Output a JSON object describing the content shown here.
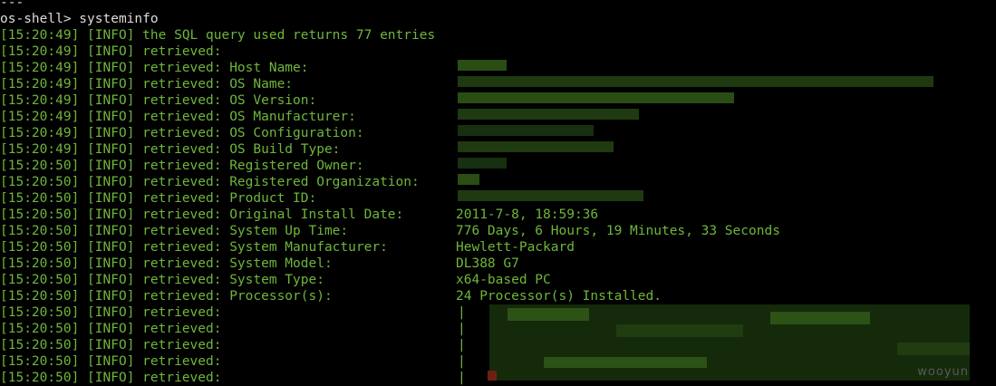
{
  "terminal": {
    "top_fragment": "---",
    "prompt": "os-shell> systeminfo",
    "lines": [
      {
        "ts": "[15:20:49]",
        "level": "[INFO]",
        "text": "the SQL query used returns 77 entries",
        "value": ""
      },
      {
        "ts": "[15:20:49]",
        "level": "[INFO]",
        "text": "retrieved:",
        "value": ""
      },
      {
        "ts": "[15:20:49]",
        "level": "[INFO]",
        "text": "retrieved: Host Name:",
        "value": ""
      },
      {
        "ts": "[15:20:49]",
        "level": "[INFO]",
        "text": "retrieved: OS Name:",
        "value": ""
      },
      {
        "ts": "[15:20:49]",
        "level": "[INFO]",
        "text": "retrieved: OS Version:",
        "value": ""
      },
      {
        "ts": "[15:20:49]",
        "level": "[INFO]",
        "text": "retrieved: OS Manufacturer:",
        "value": ""
      },
      {
        "ts": "[15:20:49]",
        "level": "[INFO]",
        "text": "retrieved: OS Configuration:",
        "value": ""
      },
      {
        "ts": "[15:20:49]",
        "level": "[INFO]",
        "text": "retrieved: OS Build Type:",
        "value": ""
      },
      {
        "ts": "[15:20:50]",
        "level": "[INFO]",
        "text": "retrieved: Registered Owner:",
        "value": ""
      },
      {
        "ts": "[15:20:50]",
        "level": "[INFO]",
        "text": "retrieved: Registered Organization:",
        "value": ""
      },
      {
        "ts": "[15:20:50]",
        "level": "[INFO]",
        "text": "retrieved: Product ID:",
        "value": ""
      },
      {
        "ts": "[15:20:50]",
        "level": "[INFO]",
        "text": "retrieved: Original Install Date:",
        "value": "2011-7-8, 18:59:36"
      },
      {
        "ts": "[15:20:50]",
        "level": "[INFO]",
        "text": "retrieved: System Up Time:",
        "value": "776 Days, 6 Hours, 19 Minutes, 33 Seconds"
      },
      {
        "ts": "[15:20:50]",
        "level": "[INFO]",
        "text": "retrieved: System Manufacturer:",
        "value": "Hewlett-Packard"
      },
      {
        "ts": "[15:20:50]",
        "level": "[INFO]",
        "text": "retrieved: System Model:",
        "value": "DL388 G7"
      },
      {
        "ts": "[15:20:50]",
        "level": "[INFO]",
        "text": "retrieved: System Type:",
        "value": "x64-based PC"
      },
      {
        "ts": "[15:20:50]",
        "level": "[INFO]",
        "text": "retrieved: Processor(s):",
        "value": "24 Processor(s) Installed."
      },
      {
        "ts": "[15:20:50]",
        "level": "[INFO]",
        "text": "retrieved:",
        "value": "|"
      },
      {
        "ts": "[15:20:50]",
        "level": "[INFO]",
        "text": "retrieved:",
        "value": "|"
      },
      {
        "ts": "[15:20:50]",
        "level": "[INFO]",
        "text": "retrieved:",
        "value": "|"
      },
      {
        "ts": "[15:20:50]",
        "level": "[INFO]",
        "text": "retrieved:",
        "value": "|"
      },
      {
        "ts": "[15:20:50]",
        "level": "[INFO]",
        "text": "retrieved:",
        "value": "|"
      }
    ]
  },
  "watermark": "wooyun",
  "colors": {
    "background": "#000000",
    "text_green": "#6fb63a",
    "prompt_white": "#dcdcdc",
    "redaction_green": "#1f3a10"
  }
}
